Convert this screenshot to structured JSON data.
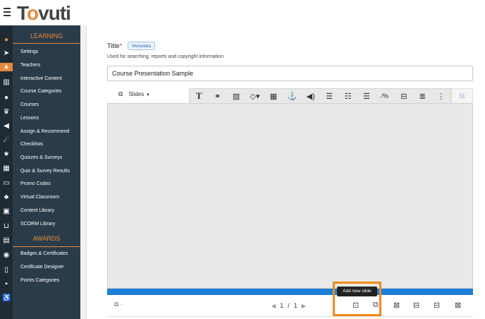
{
  "brand": {
    "logo_text_a": "T",
    "logo_text_o": "o",
    "logo_text_b": "vuti"
  },
  "sidebar": {
    "sections": [
      {
        "label": "LEARNING"
      },
      {
        "label": "AWARDS"
      }
    ],
    "learning_items": [
      "Settings",
      "Teachers",
      "Interactive Content",
      "Course Categories",
      "Courses",
      "Lessons",
      "Assign & Recommend",
      "Checklists",
      "Quizzes & Surveys",
      "Quiz & Survey Results",
      "Promo Codes",
      "Virtual Classroom",
      "Content Library",
      "SCORM Library"
    ],
    "awards_items": [
      "Badges & Certificates",
      "Certificate Designer",
      "Points Categories"
    ]
  },
  "form": {
    "title_label": "Title",
    "required_mark": "*",
    "metadata_badge": "Metadata",
    "help_text": "Used for searching, reports and copyright information",
    "title_value": "Course Presentation Sample"
  },
  "editor": {
    "slides_dropdown": "Slides",
    "toolbar_icons": [
      "text-icon",
      "link-icon",
      "image-icon",
      "shapes-icon",
      "video-icon",
      "anchor-icon",
      "audio-icon",
      "settings-sliders-icon",
      "single-choice-icon",
      "multi-choice-icon",
      "fill-blanks-icon",
      "drag-drop-icon",
      "summary-list-icon",
      "more-icon"
    ],
    "pager": {
      "current": "1",
      "separator": "/",
      "total": "1"
    },
    "tooltip": "Add new slide"
  }
}
